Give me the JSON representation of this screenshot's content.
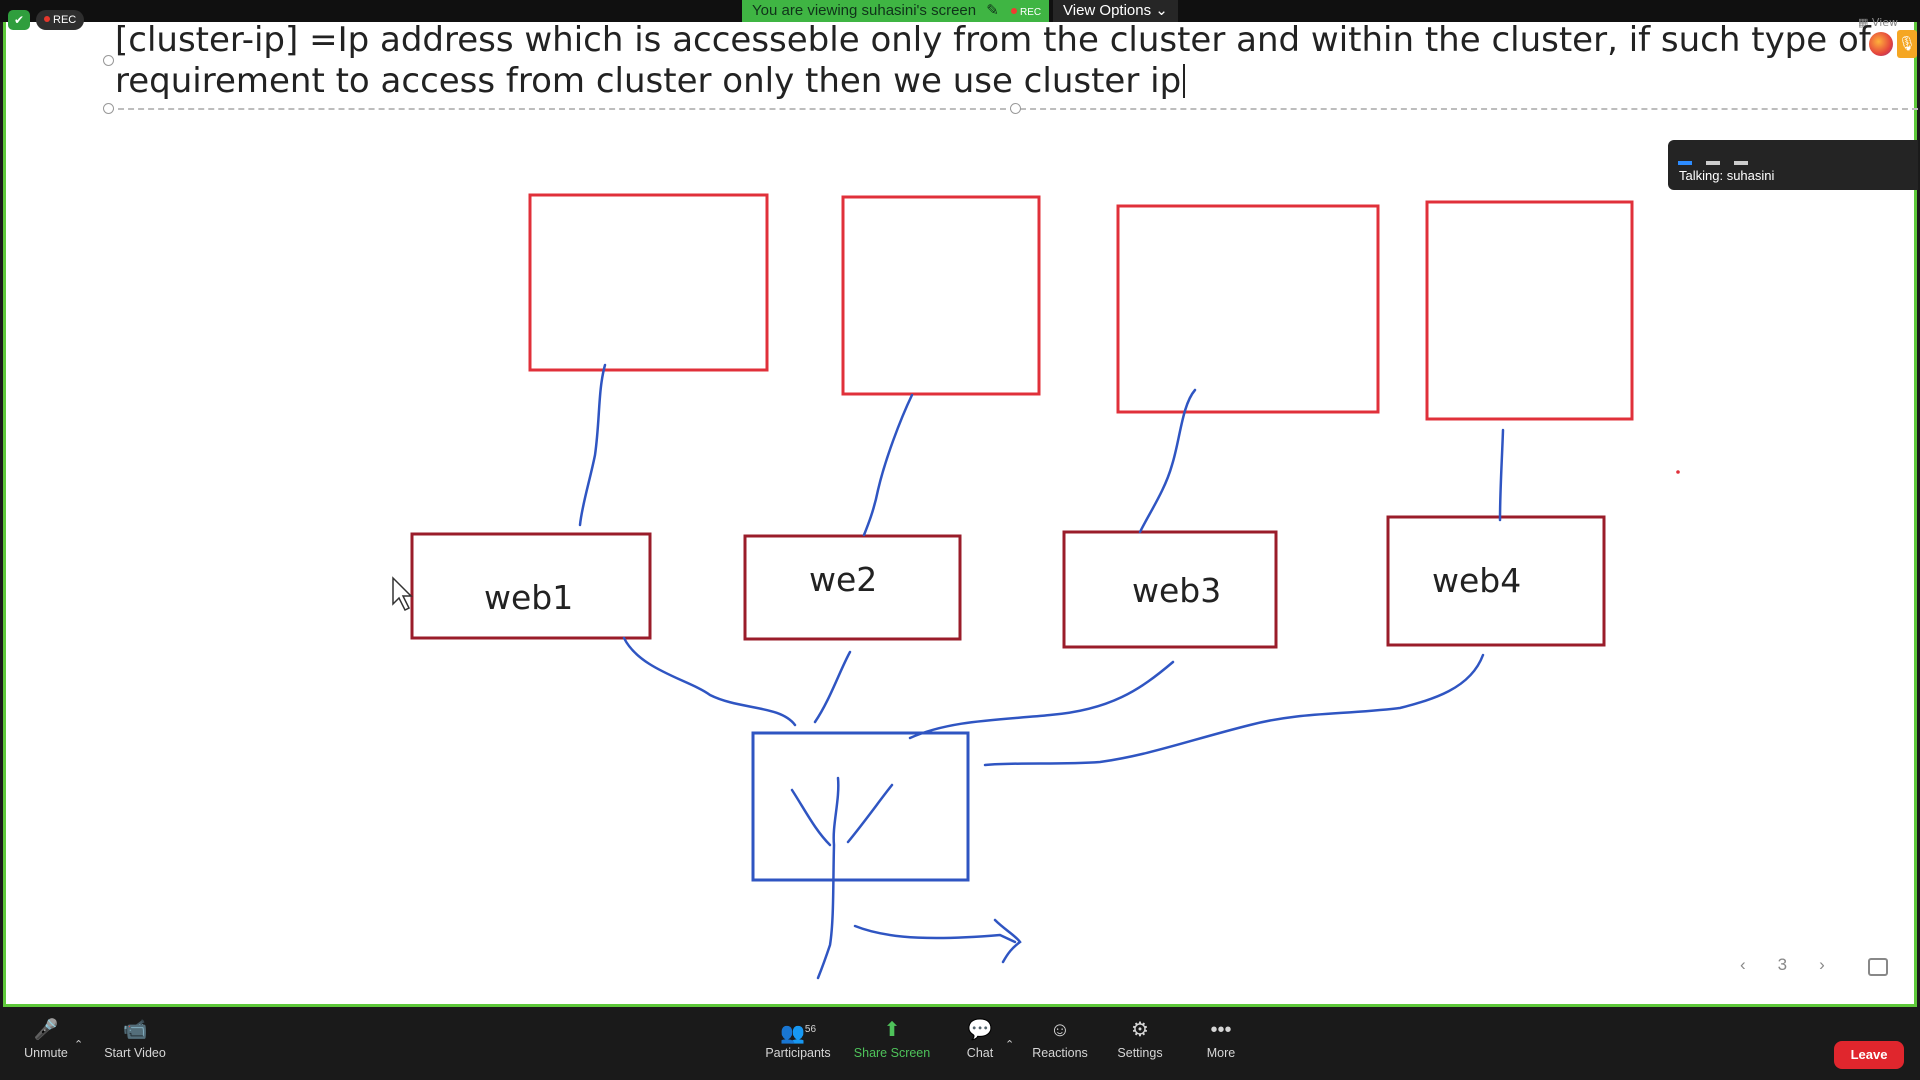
{
  "meeting": {
    "rec_badge": "REC",
    "viewing_banner": "You are viewing suhasini's screen",
    "banner_rec": "REC",
    "view_options": "View Options",
    "view_mini": "View"
  },
  "slide": {
    "line1": "[cluster-ip] =Ip address which is accesseble only from the cluster and within the cluster, if such type of",
    "line2": "requirement to access from cluster only then we use cluster ip",
    "page_number": "3"
  },
  "diagram": {
    "web_boxes": [
      {
        "label": "web1"
      },
      {
        "label": "we2"
      },
      {
        "label": "web3"
      },
      {
        "label": "web4"
      }
    ],
    "colors": {
      "pod_box": "#e0303a",
      "web_box": "#9a1c2a",
      "line": "#2f55c2",
      "service_box": "#2f55c2"
    }
  },
  "talking": {
    "label": "Talking: suhasini"
  },
  "toolbar": {
    "unmute": "Unmute",
    "start_video": "Start Video",
    "participants": "Participants",
    "participants_count": "56",
    "share_screen": "Share Screen",
    "chat": "Chat",
    "reactions": "Reactions",
    "settings": "Settings",
    "more": "More",
    "leave": "Leave"
  }
}
